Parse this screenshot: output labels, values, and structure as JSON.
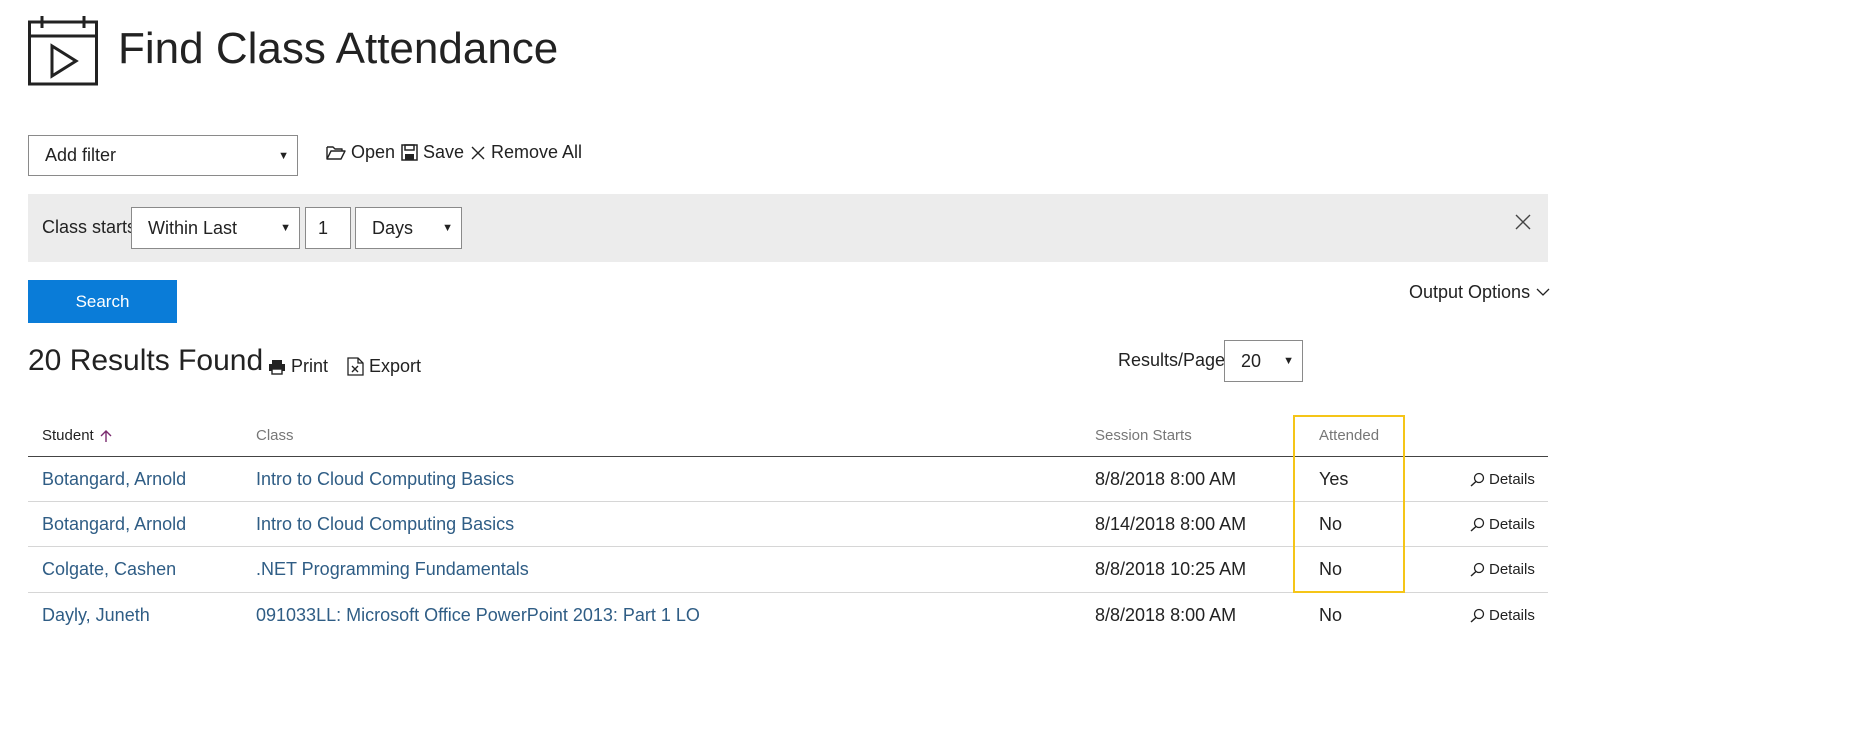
{
  "page": {
    "title": "Find Class Attendance",
    "icon": "calendar-play-icon"
  },
  "toolbar": {
    "add_filter": "Add filter",
    "open_label": "Open",
    "save_label": "Save",
    "remove_all_label": "Remove All"
  },
  "filter": {
    "label": "Class starts",
    "operator": "Within Last",
    "value": "1",
    "unit": "Days"
  },
  "search_label": "Search",
  "output_options_label": "Output Options",
  "results": {
    "count_text": "20 Results Found",
    "print_label": "Print",
    "export_label": "Export",
    "per_page_label": "Results/Page:",
    "per_page_value": "20"
  },
  "table": {
    "columns": {
      "student": "Student",
      "class": "Class",
      "session_starts": "Session Starts",
      "attended": "Attended"
    },
    "details_label": "Details",
    "rows": [
      {
        "student": "Botangard, Arnold",
        "class": "Intro to Cloud Computing Basics",
        "session_starts": "8/8/2018 8:00 AM",
        "attended": "Yes"
      },
      {
        "student": "Botangard, Arnold",
        "class": "Intro to Cloud Computing Basics",
        "session_starts": "8/14/2018 8:00 AM",
        "attended": "No"
      },
      {
        "student": "Colgate, Cashen",
        "class": ".NET Programming Fundamentals",
        "session_starts": "8/8/2018 10:25 AM",
        "attended": "No"
      },
      {
        "student": "Dayly, Juneth",
        "class": "091033LL: Microsoft Office PowerPoint 2013: Part 1 LO",
        "session_starts": "8/8/2018 8:00 AM",
        "attended": "No"
      }
    ]
  },
  "colors": {
    "accent": "#0a7cd8",
    "link": "#2f5d85",
    "highlight": "#f5c518",
    "filter_bg": "#ececec"
  }
}
